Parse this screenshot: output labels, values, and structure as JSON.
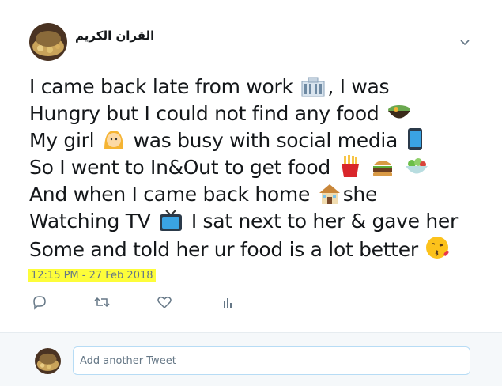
{
  "author": {
    "name": "القران الكريم"
  },
  "tweet": {
    "lines": [
      "I came back late from work",
      ", I was",
      "Hungry but I could not find any food",
      "My girl",
      "was busy with social media",
      "So I went to In&Out to get food",
      "And when I came back home",
      "she",
      "Watching TV",
      "I sat next to her & gave her",
      "Some and told her ur food is a lot better"
    ]
  },
  "timestamp": "12:15 PM - 27 Feb 2018",
  "reply": {
    "placeholder": "Add another Tweet"
  },
  "icons": [
    "chevron-down-icon",
    "reply-icon",
    "retweet-icon",
    "like-icon",
    "analytics-icon",
    "office-building-emoji",
    "curry-bowl-emoji",
    "girl-emoji",
    "mobile-phone-emoji",
    "fries-emoji",
    "burger-emoji",
    "salad-emoji",
    "house-emoji",
    "tv-emoji",
    "kissing-face-emoji"
  ],
  "colors": {
    "highlight": "#fdfd3a",
    "secondary_text": "#657786",
    "input_border": "#b7dcf5"
  }
}
